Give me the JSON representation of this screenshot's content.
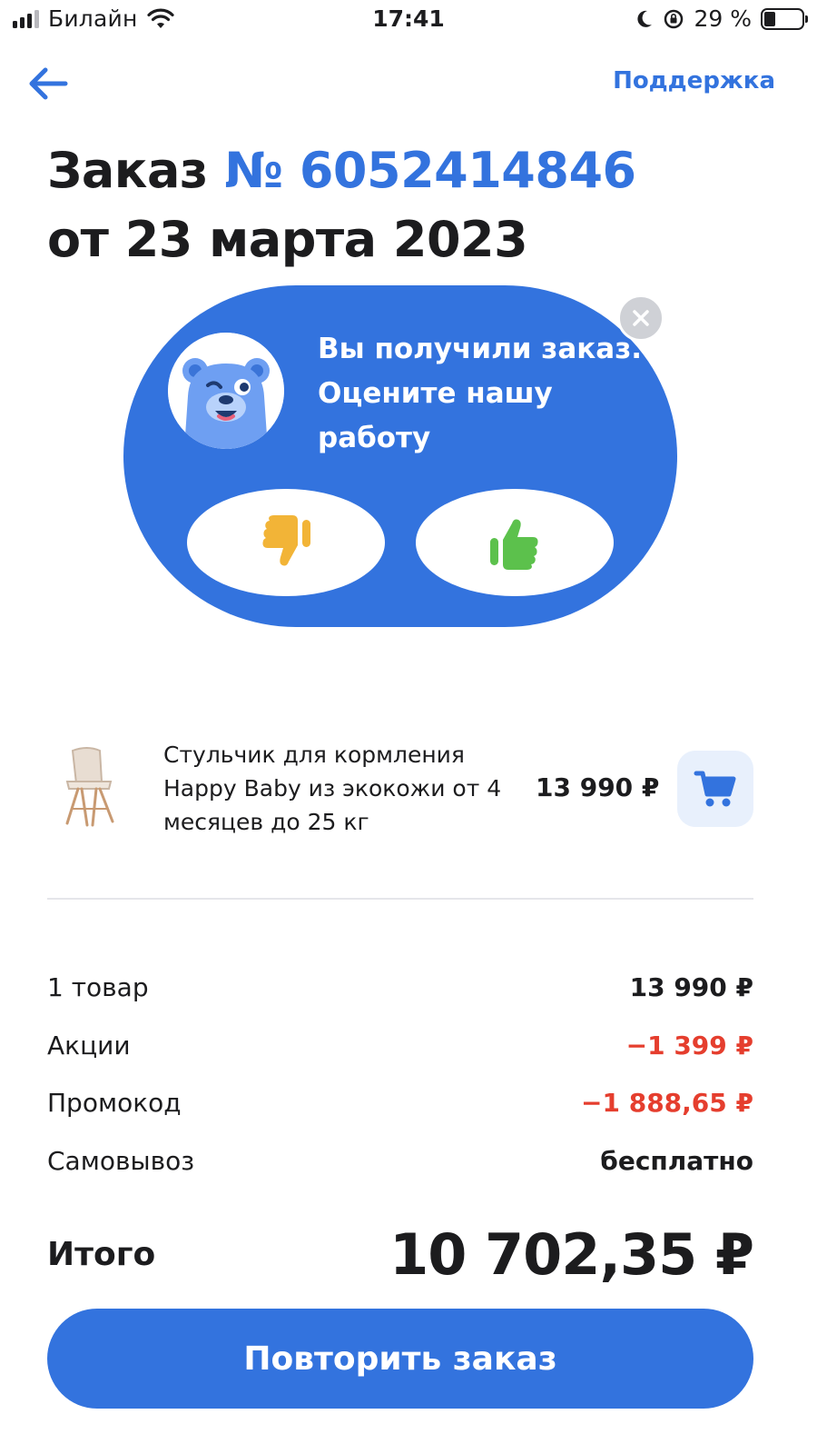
{
  "status_bar": {
    "carrier": "Билайн",
    "time": "17:41",
    "battery_percent": "29 %",
    "battery_level": 0.29
  },
  "nav": {
    "support_label": "Поддержка"
  },
  "order": {
    "title_prefix": "Заказ",
    "number": "№ 6052414846",
    "date_line": "от 23 марта 2023"
  },
  "rating_card": {
    "text": "Вы получили заказ. Оцените нашу работу",
    "colors": {
      "background": "#3373de",
      "dislike": "#f2b437",
      "like": "#5cc14c"
    }
  },
  "product": {
    "title": "Стульчик для кормления Happy Baby из экокожи от 4 месяцев до 25 кг",
    "price": "13 990 ₽"
  },
  "summary": {
    "items": [
      {
        "label": "1 товар",
        "value": "13 990 ₽",
        "color": "#1c1c1e"
      },
      {
        "label": "Акции",
        "value": "−1 399 ₽",
        "color": "#e53e2e"
      },
      {
        "label": "Промокод",
        "value": "−1 888,65 ₽",
        "color": "#e53e2e"
      },
      {
        "label": "Самовывоз",
        "value": "бесплатно",
        "color": "#1c1c1e"
      }
    ],
    "total_label": "Итого",
    "total_value": "10 702,35 ₽"
  },
  "actions": {
    "repeat_label": "Повторить заказ"
  },
  "icons": [
    "back-arrow-icon",
    "close-icon",
    "thumbs-down-icon",
    "thumbs-up-icon",
    "cart-icon",
    "wifi-icon",
    "battery-icon",
    "moon-icon",
    "rotation-lock-icon"
  ]
}
